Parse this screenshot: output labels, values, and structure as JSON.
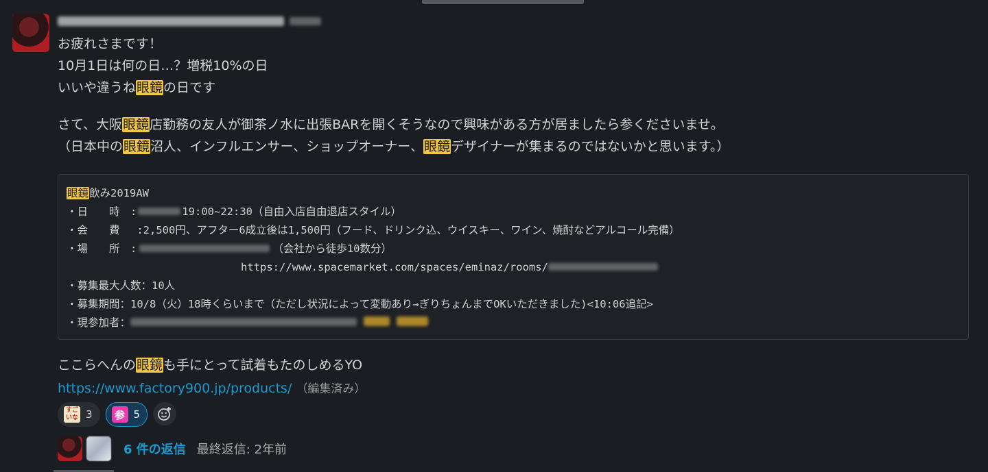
{
  "message": {
    "greeting": "お疲れさまです！",
    "line2": "10月1日は何の日…？増税10%の日",
    "line3_pre": "いいや違うね",
    "highlight": "眼鏡",
    "line3_post": "の日です",
    "para2_a": "さて、大阪",
    "para2_b": "店勤務の友人が御茶ノ水に出張BARを開くそうなので興味がある方が居ましたら参くださいませ。",
    "para3_a": "（日本中の",
    "para3_b": "沼人、インフルエンサー、ショップオーナー、",
    "para3_c": "デザイナーが集まるのではないかと思います。）"
  },
  "code_block": {
    "title_post": "飲み2019AW",
    "date_label": "・日　　時　:",
    "date_value": "19:00~22:30（自由入店自由退店スタイル）",
    "fee_label": "・会　　費　 :",
    "fee_value": "2,500円、アフター6成立後は1,500円（フード、ドリンク込、ウイスキー、ワイン、焼酎などアルコール完備）",
    "place_label": "・場　　所　:",
    "place_value": "（会社から徒歩10数分）",
    "url": "https://www.spacemarket.com/spaces/eminaz/rooms/",
    "max_people": "・募集最大人数：10人",
    "period": "・募集期間：10/8（火）18時くらいまで（ただし状況によって変動あり→ぎりちょんまでOKいただきました)<10:06追記>",
    "participants_label": "・現参加者："
  },
  "after": {
    "text_pre": "ここらへんの",
    "text_post": "も手にとって試着もたのしめるYO",
    "link": "https://www.factory900.jp/products/",
    "edited": "（編集済み）"
  },
  "reactions": [
    {
      "emoji_text": "すご いな",
      "count": "3"
    },
    {
      "emoji_text": "参",
      "count": "5"
    }
  ],
  "thread": {
    "replies": "6 件の返信",
    "last_reply": "最終返信: 2年前"
  },
  "colors": {
    "background": "#1a1d21",
    "highlight": "#f2c744",
    "link": "#1d9bd1"
  },
  "icons": [
    "add-reaction-icon"
  ]
}
